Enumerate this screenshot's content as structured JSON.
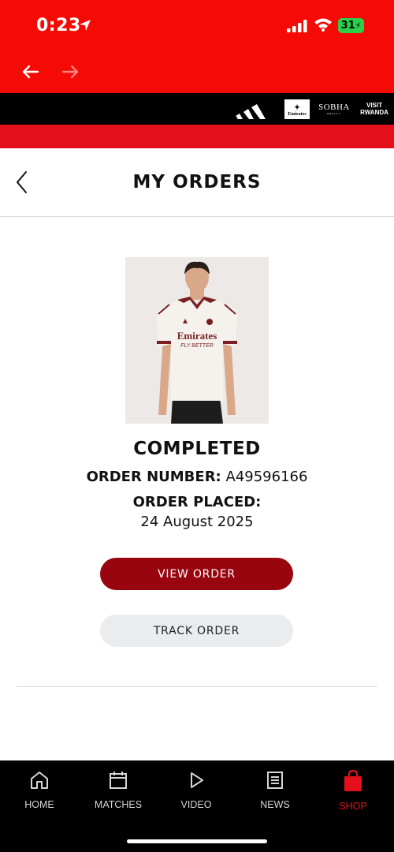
{
  "status_bar": {
    "time": "0:23",
    "battery": "31"
  },
  "sponsors": {
    "emirates": "Emirates",
    "sobha": "SOBHA",
    "sobha_sub": "REALTY",
    "rwanda_line1": "VISIT",
    "rwanda_line2": "RWANDA"
  },
  "header": {
    "title": "MY ORDERS"
  },
  "order": {
    "status": "COMPLETED",
    "number_label": "ORDER NUMBER:",
    "number": "A49596166",
    "placed_label": "ORDER PLACED:",
    "date": "24 August 2025",
    "shirt_sponsor": "Emirates",
    "shirt_sponsor_sub": "FLY BETTER"
  },
  "buttons": {
    "view": "VIEW ORDER",
    "track": "TRACK ORDER"
  },
  "tabs": [
    {
      "label": "HOME",
      "icon": "home-icon"
    },
    {
      "label": "MATCHES",
      "icon": "calendar-icon"
    },
    {
      "label": "VIDEO",
      "icon": "play-icon"
    },
    {
      "label": "NEWS",
      "icon": "news-icon"
    },
    {
      "label": "SHOP",
      "icon": "shopping-bag-icon",
      "active": true
    }
  ],
  "colors": {
    "brand_red": "#f50a05",
    "button_red": "#99050f",
    "active_tab": "#e3101c"
  }
}
